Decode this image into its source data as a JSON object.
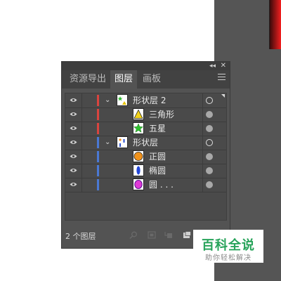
{
  "panel": {
    "collapse_glyph": "◂◂",
    "close_glyph": "✕",
    "tabs": [
      {
        "label": "资源导出",
        "active": false
      },
      {
        "label": "图层",
        "active": true
      },
      {
        "label": "画板",
        "active": false
      }
    ]
  },
  "layers": [
    {
      "name": "形状层 2",
      "level": 0,
      "expandable": true,
      "color": "#d9443f",
      "target": "hollow",
      "thumb": "group-star-triangle"
    },
    {
      "name": "三角形",
      "level": 1,
      "expandable": false,
      "color": "#d9443f",
      "target": "filled",
      "thumb": "triangle"
    },
    {
      "name": "五星",
      "level": 1,
      "expandable": false,
      "color": "#d9443f",
      "target": "filled",
      "thumb": "star"
    },
    {
      "name": "形状层",
      "level": 0,
      "expandable": true,
      "color": "#4a78d4",
      "target": "hollow",
      "thumb": "group-shapes"
    },
    {
      "name": "正圆",
      "level": 1,
      "expandable": false,
      "color": "#4a78d4",
      "target": "filled",
      "thumb": "circle"
    },
    {
      "name": "椭圆",
      "level": 1,
      "expandable": false,
      "color": "#4a78d4",
      "target": "filled",
      "thumb": "ellipse"
    },
    {
      "name": "圆 . . .",
      "level": 1,
      "expandable": false,
      "color": "#4a78d4",
      "target": "filled",
      "thumb": "pink-circle"
    }
  ],
  "footer": {
    "layer_count": "2 个图层"
  },
  "watermark": {
    "title": "百科全说",
    "subtitle": "助你轻松解决"
  },
  "colors": {
    "panel_bg": "#535353",
    "tabbar_bg": "#424242",
    "red_layer": "#d9443f",
    "blue_layer": "#4a78d4",
    "watermark_green": "#27a35a"
  }
}
